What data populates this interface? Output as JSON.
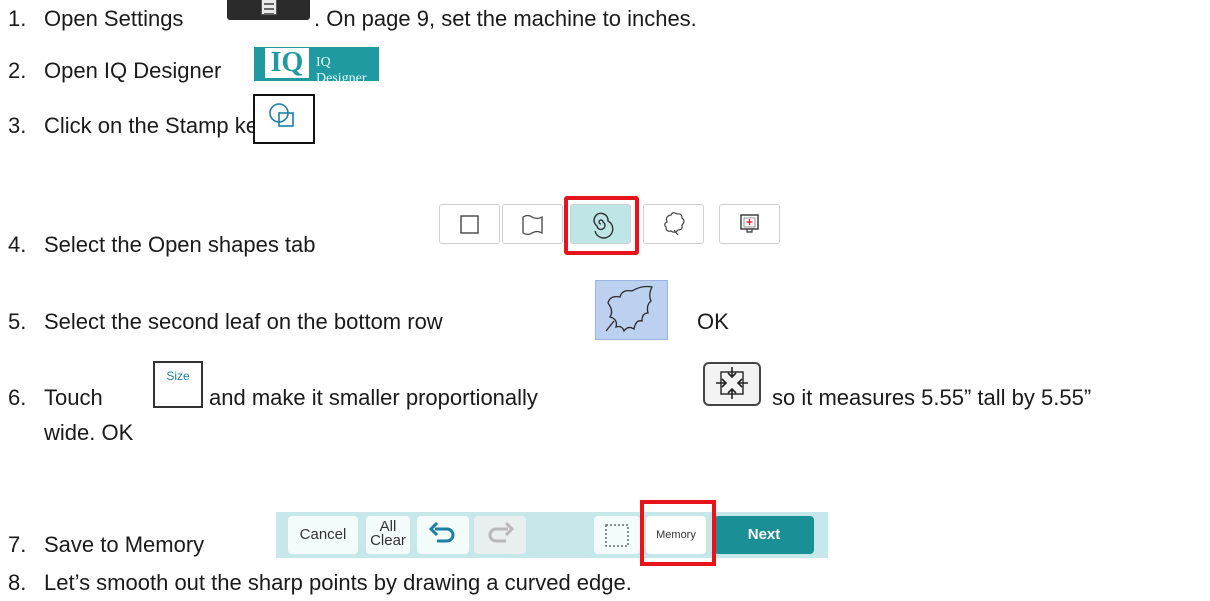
{
  "steps": [
    {
      "num": "1.",
      "text_a": "Open Settings",
      "text_b": ". On page 9, set the machine to inches."
    },
    {
      "num": "2.",
      "text_a": "Open IQ Designer"
    },
    {
      "num": "3.",
      "text_a": "Click on the Stamp key"
    },
    {
      "num": "4.",
      "text_a": "Select the Open shapes tab"
    },
    {
      "num": "5.",
      "text_a": "Select the second leaf on the bottom row",
      "text_b": "OK"
    },
    {
      "num": "6.",
      "text_a": "Touch",
      "text_b": "and make it smaller proportionally",
      "text_c": "so it measures 5.55” tall by 5.55”",
      "text_d": "wide. OK"
    },
    {
      "num": "7.",
      "text_a": "Save to Memory"
    },
    {
      "num": "8.",
      "text_a": "Let’s smooth out the sharp points by drawing a curved edge."
    }
  ],
  "iq_designer": {
    "logo": "IQ",
    "label": "IQ Designer"
  },
  "size_button": {
    "label": "Size"
  },
  "toolbar": {
    "cancel": "Cancel",
    "all_clear_1": "All",
    "all_clear_2": "Clear",
    "memory": "Memory",
    "next": "Next"
  },
  "colors": {
    "highlight": "#e8141c",
    "teal": "#1a8f96",
    "tab_selected": "#bfe6e6",
    "toolbar_bg": "#c6e8ea",
    "leaf_bg": "#bcd0f0"
  },
  "icons": {
    "settings": "settings-icon",
    "stamp": "stamp-shapes-icon",
    "tabs": [
      "square-shape-icon",
      "wave-frame-icon",
      "spiral-icon",
      "flower-icon",
      "screen-add-icon"
    ],
    "leaf": "leaf-outline-icon",
    "shrink": "shrink-proportional-icon",
    "undo": "undo-icon",
    "redo": "redo-icon",
    "select": "dotted-select-icon"
  }
}
